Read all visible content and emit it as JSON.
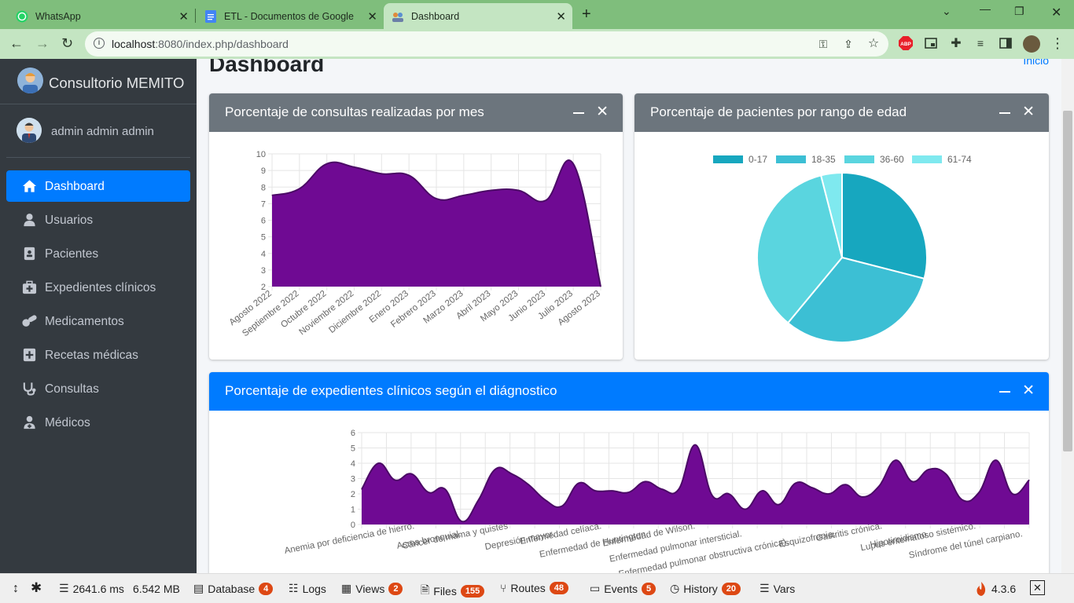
{
  "browser": {
    "tabs": [
      {
        "title": "WhatsApp",
        "icon": "whatsapp-icon"
      },
      {
        "title": "ETL - Documentos de Google",
        "icon": "google-docs-icon"
      },
      {
        "title": "Dashboard",
        "icon": "app-favicon-icon"
      }
    ],
    "url_host": "localhost",
    "url_path": ":8080/index.php/dashboard"
  },
  "sidebar": {
    "brand": "Consultorio MEMITO",
    "user": "admin admin admin",
    "items": [
      {
        "label": "Dashboard",
        "icon": "home-icon",
        "active": true
      },
      {
        "label": "Usuarios",
        "icon": "user-icon"
      },
      {
        "label": "Pacientes",
        "icon": "patient-card-icon"
      },
      {
        "label": "Expedientes clínicos",
        "icon": "medical-kit-icon"
      },
      {
        "label": "Medicamentos",
        "icon": "pills-icon"
      },
      {
        "label": "Recetas médicas",
        "icon": "plus-square-icon"
      },
      {
        "label": "Consultas",
        "icon": "stethoscope-icon"
      },
      {
        "label": "Médicos",
        "icon": "doctor-icon"
      }
    ]
  },
  "page": {
    "title": "Dashboard",
    "breadcrumb": "Inicio"
  },
  "cards": {
    "consultas": {
      "title": "Porcentaje de consultas realizadas por mes",
      "header_color": "#6c757d"
    },
    "edad": {
      "title": "Porcentaje de pacientes por rango de edad",
      "header_color": "#6c757d"
    },
    "diagnostico": {
      "title": "Porcentaje de expedientes clínicos según el diágnostico",
      "header_color": "#007bff"
    }
  },
  "chart_data": [
    {
      "type": "area",
      "categories": [
        "Agosto 2022",
        "Septiembre 2022",
        "Octubre 2022",
        "Noviembre 2022",
        "Diciembre 2022",
        "Enero 2023",
        "Febrero 2023",
        "Marzo 2023",
        "Abril 2023",
        "Mayo 2023",
        "Junio 2023",
        "Julio 2023",
        "Agosto 2023"
      ],
      "values": [
        7.5,
        7.9,
        9.4,
        9.2,
        8.8,
        8.7,
        7.3,
        7.5,
        7.8,
        7.8,
        7.2,
        9.4,
        2
      ],
      "ylim": [
        2,
        10
      ],
      "yticks": [
        2,
        3,
        4,
        5,
        6,
        7,
        8,
        9,
        10
      ],
      "color": "#6f0a93",
      "grid": true
    },
    {
      "type": "pie",
      "categories": [
        "0-17",
        "18-35",
        "36-60",
        "61-74"
      ],
      "values": [
        29,
        32,
        35,
        4
      ],
      "colors": [
        "#17a7bf",
        "#3cbfd4",
        "#5ad5df",
        "#7fe9ef"
      ],
      "legend": "top"
    },
    {
      "type": "area",
      "labels": [
        "Anemia por deficiencia de hierro.",
        "Asma bronquial.",
        "Cáncer de mama y quistes",
        "Depresión mayor.",
        "Enfermedad celíaca.",
        "Enfermedad de Huntington.",
        "Enfermedad de Wilson.",
        "Enfermedad pulmonar intersticial.",
        "Enfermedad pulmonar obstructiva crónica).",
        "Esquizofrenia.",
        "Gastritis crónica.",
        "Hipotiroidismo.",
        "Lupus eritematoso sistémico.",
        "Síndrome del túnel carpiano."
      ],
      "values": [
        2.3,
        4,
        2.9,
        3.3,
        2.1,
        2.3,
        0.2,
        1.6,
        3.6,
        3.3,
        2.6,
        1.6,
        1.2,
        2.7,
        2.2,
        2.2,
        2.1,
        2.8,
        2.3,
        2.3,
        5.2,
        1.9,
        2.0,
        1.0,
        2.2,
        1.3,
        2.7,
        2.4,
        2.0,
        2.6,
        1.8,
        2.5,
        4.2,
        2.8,
        3.6,
        3.3,
        1.6,
        2.1,
        4.2,
        2.0,
        2.9
      ],
      "ylim": [
        0,
        6
      ],
      "yticks": [
        0,
        1,
        2,
        3,
        4,
        5,
        6
      ],
      "color": "#6f0a93",
      "grid": true
    }
  ],
  "devbar": {
    "time": "2641.6 ms",
    "memory": "6.542 MB",
    "items": [
      {
        "label": "Database",
        "count": "4"
      },
      {
        "label": "Logs",
        "count": ""
      },
      {
        "label": "Views",
        "count": "2"
      },
      {
        "label": "Files",
        "count": "155"
      },
      {
        "label": "Routes",
        "count": "48"
      },
      {
        "label": "Events",
        "count": "5"
      },
      {
        "label": "History",
        "count": "20"
      },
      {
        "label": "Vars",
        "count": ""
      }
    ],
    "version": "4.3.6"
  }
}
